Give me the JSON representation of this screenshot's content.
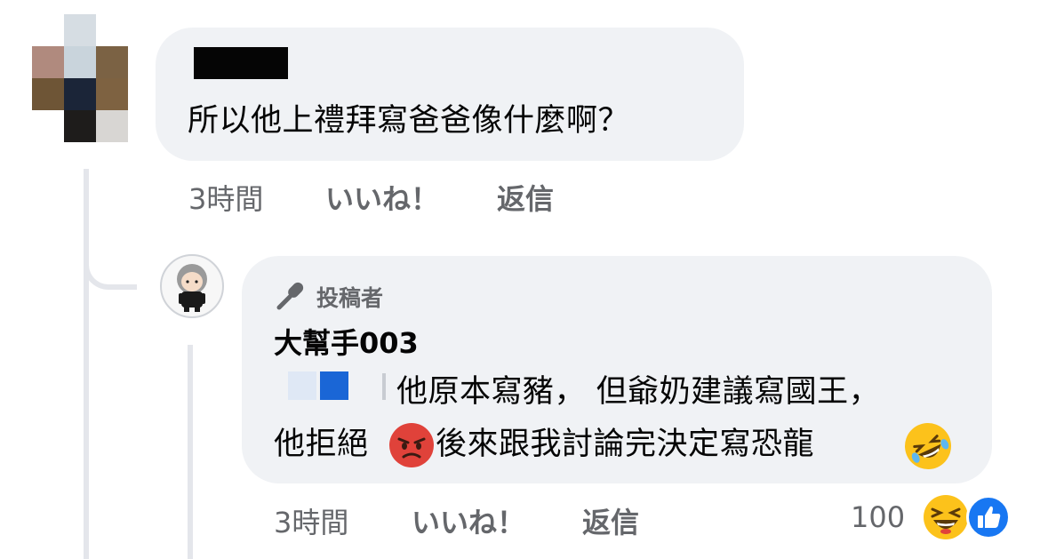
{
  "comment1": {
    "author_redacted": true,
    "text": "所以他上禮拜寫爸爸像什麼啊？",
    "time": "3時間",
    "like_label": "いいね！",
    "reply_label": "返信"
  },
  "reply1": {
    "badge_icon": "microphone-icon",
    "badge_label": "投稿者",
    "author": "大幫手003",
    "line1": "他原本寫豬， 但爺奶建議寫國王，",
    "line2_a": "他拒絕",
    "line2_b": " 後來跟我討論完決定寫恐龍",
    "emoji_1": "angry-face-emoji",
    "emoji_2": "rolling-on-floor-laughing-emoji",
    "time": "3時間",
    "like_label": "いいね！",
    "reply_label": "返信",
    "reaction_count": "100",
    "reaction_icons": [
      "haha-reaction-icon",
      "like-reaction-icon"
    ],
    "colors": {
      "like_blue": "#1877f2",
      "emoji_yellow": "#fcc21b",
      "angry_red": "#e0423a"
    }
  }
}
